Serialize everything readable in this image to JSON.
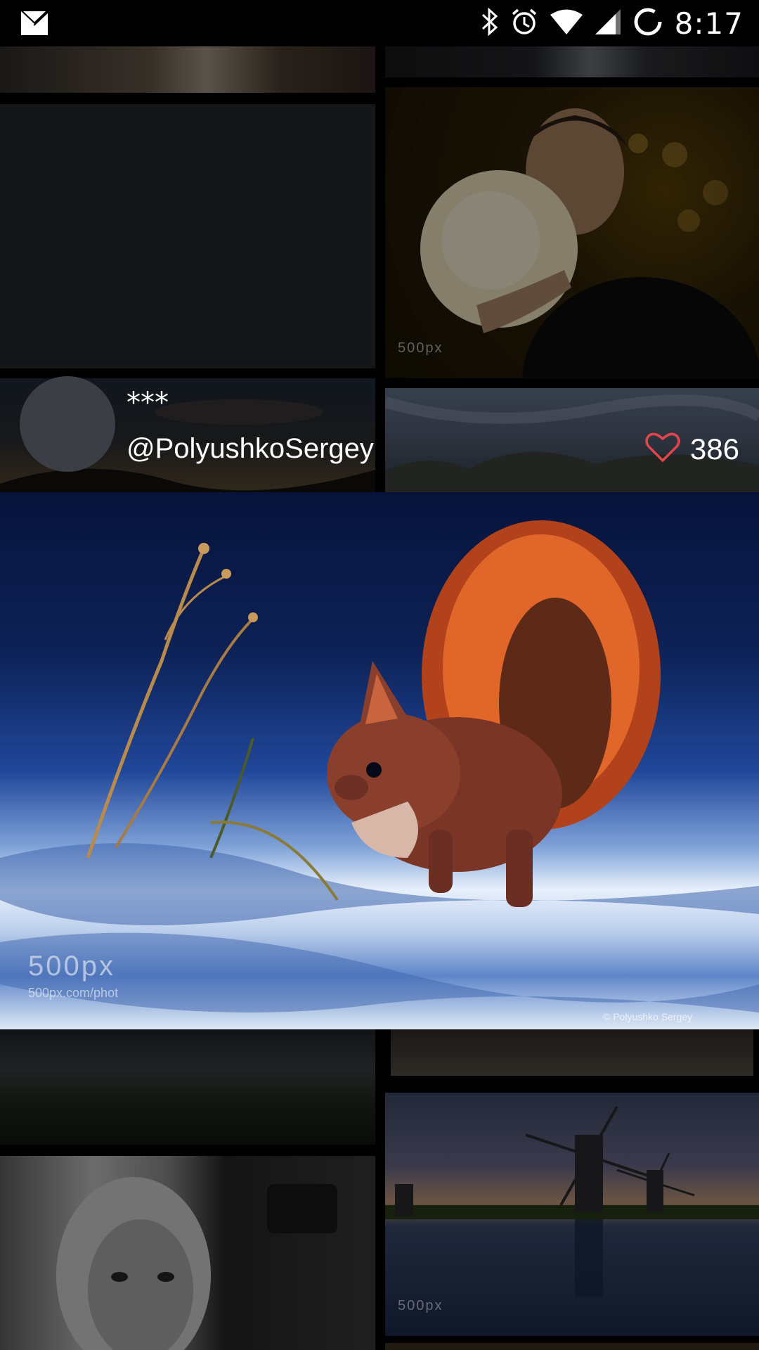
{
  "status_bar": {
    "time": "8:17",
    "icons": [
      "gmail-icon",
      "bluetooth-icon",
      "alarm-icon",
      "wifi-icon",
      "signal-icon",
      "sync-icon"
    ]
  },
  "featured_photo": {
    "title": "***",
    "author": "@PolyushkoSergey",
    "likes": "386",
    "watermark": "500px",
    "watermark_url": "500px.com/phot",
    "credit": "© Polyushko Sergey"
  },
  "colors": {
    "heart": "#e0464b",
    "background": "#000000"
  }
}
